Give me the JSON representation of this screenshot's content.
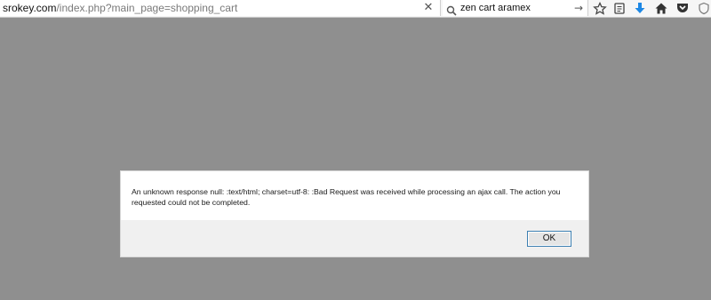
{
  "browser": {
    "url_domain": "srokey.com",
    "url_path": "/index.php?main_page=shopping_cart",
    "clear_label": "✕",
    "search_query": "zen cart aramex",
    "search_go": "→",
    "icons": [
      "bookmark-star-icon",
      "reading-list-icon",
      "download-icon",
      "home-icon",
      "pocket-icon",
      "shield-icon"
    ],
    "accent_color": "#1e88e5"
  },
  "dialog": {
    "message": "An unknown response null: :text/html; charset=utf-8: :Bad Request was received while processing an ajax call. The action you requested could not be completed.",
    "ok_label": "OK"
  }
}
